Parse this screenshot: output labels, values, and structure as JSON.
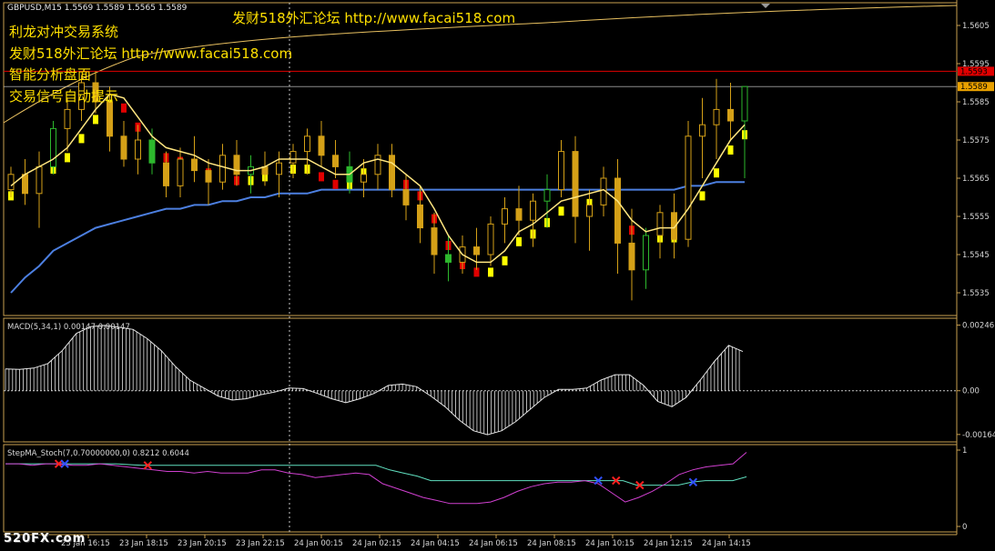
{
  "header": {
    "symbol_line": "GBPUSD,M15  1.5569 1.5589 1.5565 1.5589",
    "ad_top": "发财518外汇论坛 http://www.facai518.com",
    "ad_lines": [
      "利龙对冲交易系统",
      "发财518外汇论坛 http://www.facai518.com",
      "智能分析盘面",
      "交易信号自动提示"
    ]
  },
  "watermark": "520FX.com",
  "colors": {
    "background": "#000000",
    "axis": "#c9a050",
    "grid": "#c8c8c8",
    "bull_candle": "#d4a017",
    "bear_candle": "#d4a017",
    "green_candle": "#2db82d",
    "ma_fast": "#ffe680",
    "ma_slow": "#4c7fe0",
    "envelope_up": "#e8c060",
    "step_bull": "#ffff00",
    "step_bear": "#e00000",
    "price_red": "#e00000",
    "price_gold": "#e8a000",
    "macd": "#e6e6e6",
    "stoch_main": "#60e0c0",
    "stoch_signal": "#d040d0",
    "cross_red": "#ff2020",
    "cross_blue": "#3050ff"
  },
  "chart_data": [
    {
      "type": "line",
      "panel": "price",
      "title": "GBPUSD,M15",
      "ohlc_current": {
        "open": 1.5569,
        "high": 1.5589,
        "low": 1.5565,
        "close": 1.5589
      },
      "ylim": [
        1.553,
        1.561
      ],
      "y_ticks": [
        "1.5605",
        "1.5595",
        "1.5585",
        "1.5575",
        "1.5565",
        "1.5555",
        "1.5545",
        "1.5535"
      ],
      "price_labels": [
        {
          "value": 1.5593,
          "text": "1.5593"
        },
        {
          "value": 1.5589,
          "text": "1.5589"
        }
      ],
      "x_ticks": [
        "23 Jan 16:15",
        "23 Jan 18:15",
        "23 Jan 20:15",
        "23 Jan 22:15",
        "24 Jan 00:15",
        "24 Jan 02:15",
        "24 Jan 04:15",
        "24 Jan 06:15",
        "24 Jan 08:15",
        "24 Jan 10:15",
        "24 Jan 12:15",
        "24 Jan 14:15"
      ],
      "ma_fast": [
        1.5563,
        1.5566,
        1.5568,
        1.557,
        1.5573,
        1.5578,
        1.5583,
        1.5587,
        1.5586,
        1.5581,
        1.5576,
        1.5573,
        1.5572,
        1.5571,
        1.5569,
        1.5568,
        1.5567,
        1.5567,
        1.5568,
        1.557,
        1.557,
        1.557,
        1.5568,
        1.5566,
        1.5566,
        1.5569,
        1.557,
        1.5569,
        1.5566,
        1.5563,
        1.5557,
        1.555,
        1.5545,
        1.5543,
        1.5543,
        1.5546,
        1.5551,
        1.5553,
        1.5556,
        1.5559,
        1.556,
        1.5561,
        1.5562,
        1.5559,
        1.5554,
        1.5551,
        1.5552,
        1.5552,
        1.5557,
        1.5563,
        1.5569,
        1.5575,
        1.5579
      ],
      "ma_slow": [
        1.5535,
        1.5539,
        1.5542,
        1.5546,
        1.5548,
        1.555,
        1.5552,
        1.5553,
        1.5554,
        1.5555,
        1.5556,
        1.5557,
        1.5557,
        1.5558,
        1.5558,
        1.5559,
        1.5559,
        1.556,
        1.556,
        1.5561,
        1.5561,
        1.5561,
        1.5562,
        1.5562,
        1.5562,
        1.5562,
        1.5562,
        1.5562,
        1.5562,
        1.5562,
        1.5562,
        1.5562,
        1.5562,
        1.5562,
        1.5562,
        1.5562,
        1.5562,
        1.5562,
        1.5562,
        1.5562,
        1.5562,
        1.5562,
        1.5562,
        1.5562,
        1.5562,
        1.5562,
        1.5562,
        1.5562,
        1.5563,
        1.5563,
        1.5564,
        1.5564,
        1.5564
      ],
      "candles": [
        [
          1.5562,
          1.5568,
          1.556,
          1.5566
        ],
        [
          1.5566,
          1.557,
          1.5558,
          1.5561
        ],
        [
          1.5561,
          1.5572,
          1.5552,
          1.5568
        ],
        [
          1.5568,
          1.558,
          1.5566,
          1.5578
        ],
        [
          1.5578,
          1.5586,
          1.5572,
          1.5583
        ],
        [
          1.5583,
          1.5592,
          1.558,
          1.559
        ],
        [
          1.559,
          1.5593,
          1.5582,
          1.5585
        ],
        [
          1.5585,
          1.5589,
          1.5572,
          1.5576
        ],
        [
          1.5576,
          1.558,
          1.5568,
          1.557
        ],
        [
          1.557,
          1.5579,
          1.5566,
          1.5575
        ],
        [
          1.5575,
          1.5578,
          1.5566,
          1.5569
        ],
        [
          1.5569,
          1.5572,
          1.556,
          1.5563
        ],
        [
          1.5563,
          1.5573,
          1.556,
          1.557
        ],
        [
          1.557,
          1.5576,
          1.5564,
          1.5567
        ],
        [
          1.5567,
          1.557,
          1.5558,
          1.5564
        ],
        [
          1.5564,
          1.5574,
          1.5562,
          1.5571
        ],
        [
          1.5571,
          1.5575,
          1.5563,
          1.5566
        ],
        [
          1.5566,
          1.5571,
          1.5561,
          1.5568
        ],
        [
          1.5568,
          1.5572,
          1.5563,
          1.5566
        ],
        [
          1.5566,
          1.5572,
          1.556,
          1.5569
        ],
        [
          1.5569,
          1.5574,
          1.5565,
          1.5572
        ],
        [
          1.5572,
          1.5578,
          1.5566,
          1.5576
        ],
        [
          1.5576,
          1.558,
          1.5568,
          1.5571
        ],
        [
          1.5571,
          1.5575,
          1.5565,
          1.5568
        ],
        [
          1.5568,
          1.5572,
          1.5561,
          1.5564
        ],
        [
          1.5564,
          1.557,
          1.556,
          1.5566
        ],
        [
          1.5566,
          1.5574,
          1.5562,
          1.5571
        ],
        [
          1.5571,
          1.5574,
          1.556,
          1.5562
        ],
        [
          1.5562,
          1.5566,
          1.5554,
          1.5558
        ],
        [
          1.5558,
          1.5563,
          1.5548,
          1.5552
        ],
        [
          1.5552,
          1.5556,
          1.554,
          1.5545
        ],
        [
          1.5545,
          1.555,
          1.5538,
          1.5543
        ],
        [
          1.5543,
          1.555,
          1.554,
          1.5547
        ],
        [
          1.5547,
          1.5552,
          1.5541,
          1.5545
        ],
        [
          1.5545,
          1.5555,
          1.5542,
          1.5553
        ],
        [
          1.5553,
          1.556,
          1.5548,
          1.5557
        ],
        [
          1.5557,
          1.5563,
          1.555,
          1.5554
        ],
        [
          1.5554,
          1.5561,
          1.5547,
          1.5559
        ],
        [
          1.5559,
          1.5566,
          1.5552,
          1.5562
        ],
        [
          1.5562,
          1.5575,
          1.556,
          1.5572
        ],
        [
          1.5572,
          1.5576,
          1.5548,
          1.5555
        ],
        [
          1.5555,
          1.5562,
          1.5546,
          1.5558
        ],
        [
          1.5558,
          1.5568,
          1.5555,
          1.5565
        ],
        [
          1.5565,
          1.557,
          1.554,
          1.5548
        ],
        [
          1.5548,
          1.5557,
          1.5533,
          1.5541
        ],
        [
          1.5541,
          1.5552,
          1.5536,
          1.555
        ],
        [
          1.555,
          1.5558,
          1.5544,
          1.5556
        ],
        [
          1.5556,
          1.5561,
          1.5544,
          1.5549
        ],
        [
          1.5549,
          1.558,
          1.5547,
          1.5576
        ],
        [
          1.5576,
          1.5586,
          1.5565,
          1.5579
        ],
        [
          1.5579,
          1.5591,
          1.557,
          1.5583
        ],
        [
          1.5583,
          1.559,
          1.5575,
          1.558
        ],
        [
          1.558,
          1.5589,
          1.5565,
          1.5589
        ]
      ]
    },
    {
      "type": "bar",
      "panel": "macd",
      "title": "MACD(5,34,1) 0.00147 0.00147",
      "ylim": [
        -0.00185,
        0.00265
      ],
      "y_ticks": [
        "0.00246",
        "0.00",
        "-0.00164"
      ],
      "values": [
        0.00082,
        0.0008,
        0.00085,
        0.00102,
        0.0015,
        0.00215,
        0.0024,
        0.00245,
        0.00238,
        0.0023,
        0.00195,
        0.0015,
        0.0009,
        0.0004,
        0.0001,
        -0.0002,
        -0.00035,
        -0.0003,
        -0.00015,
        -5e-05,
        0.0001,
        8e-05,
        -0.0001,
        -0.0003,
        -0.00045,
        -0.0003,
        -0.0001,
        0.0002,
        0.00025,
        0.00015,
        -0.0002,
        -0.0006,
        -0.0011,
        -0.0015,
        -0.00165,
        -0.0015,
        -0.00115,
        -0.0007,
        -0.00025,
        5e-05,
        5e-05,
        0.0001,
        0.0004,
        0.0006,
        0.0006,
        0.0002,
        -0.0004,
        -0.0006,
        -0.00025,
        0.0004,
        0.0011,
        0.0017,
        0.00147
      ]
    },
    {
      "type": "line",
      "panel": "stoch",
      "title": "StepMA_Stoch(7,0.70000000,0) 0.8212 0.6044",
      "ylim": [
        0,
        1
      ],
      "y_ticks": [
        "1",
        "0"
      ],
      "series": [
        {
          "name": "",
          "values": [
            0.82,
            0.82,
            0.82,
            0.82,
            0.82,
            0.82,
            0.82,
            0.82,
            0.82,
            0.81,
            0.8,
            0.8,
            0.8,
            0.8,
            0.8,
            0.8,
            0.8,
            0.8,
            0.8,
            0.8,
            0.8,
            0.8,
            0.8,
            0.8,
            0.8,
            0.8,
            0.8,
            0.8,
            0.74,
            0.7,
            0.66,
            0.6,
            0.6,
            0.6,
            0.6,
            0.6,
            0.6,
            0.6,
            0.6,
            0.6,
            0.6,
            0.6,
            0.6,
            0.6,
            0.6,
            0.6,
            0.54,
            0.54,
            0.54,
            0.54,
            0.58,
            0.6,
            0.6,
            0.6,
            0.65
          ]
        },
        {
          "name": "",
          "values": [
            0.82,
            0.82,
            0.8,
            0.82,
            0.82,
            0.8,
            0.8,
            0.82,
            0.8,
            0.78,
            0.76,
            0.74,
            0.72,
            0.72,
            0.7,
            0.72,
            0.7,
            0.7,
            0.7,
            0.74,
            0.74,
            0.7,
            0.68,
            0.64,
            0.66,
            0.68,
            0.7,
            0.68,
            0.56,
            0.5,
            0.44,
            0.38,
            0.34,
            0.3,
            0.3,
            0.3,
            0.32,
            0.38,
            0.46,
            0.52,
            0.56,
            0.58,
            0.58,
            0.6,
            0.56,
            0.44,
            0.32,
            0.38,
            0.46,
            0.56,
            0.68,
            0.74,
            0.78,
            0.8,
            0.82,
            0.97
          ]
        }
      ],
      "cross_markers": [
        {
          "x": 9,
          "color": "red"
        },
        {
          "x": 10,
          "color": "blue"
        },
        {
          "x": 24,
          "color": "red"
        },
        {
          "x": 100,
          "color": "blue"
        },
        {
          "x": 103,
          "color": "red"
        },
        {
          "x": 107,
          "color": "red"
        },
        {
          "x": 116,
          "color": "blue"
        }
      ]
    }
  ]
}
